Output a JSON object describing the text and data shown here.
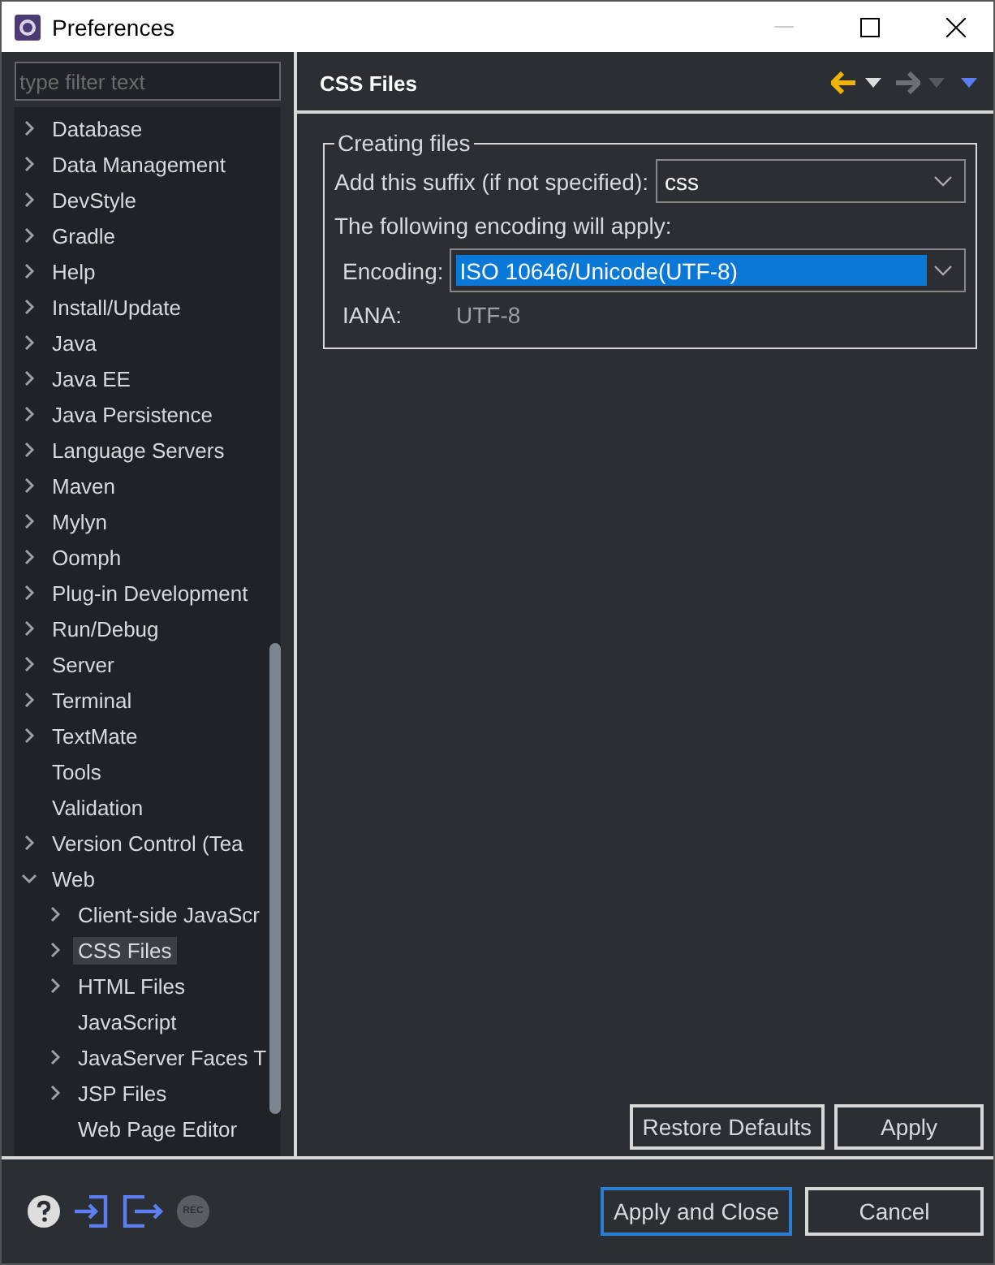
{
  "window": {
    "title": "Preferences"
  },
  "filter": {
    "placeholder": "type filter text"
  },
  "tree": [
    {
      "label": "Database",
      "kind": "branch",
      "expanded": false,
      "selected": false
    },
    {
      "label": "Data Management",
      "kind": "branch",
      "expanded": false,
      "selected": false
    },
    {
      "label": "DevStyle",
      "kind": "branch",
      "expanded": false,
      "selected": false
    },
    {
      "label": "Gradle",
      "kind": "branch",
      "expanded": false,
      "selected": false
    },
    {
      "label": "Help",
      "kind": "branch",
      "expanded": false,
      "selected": false
    },
    {
      "label": "Install/Update",
      "kind": "branch",
      "expanded": false,
      "selected": false
    },
    {
      "label": "Java",
      "kind": "branch",
      "expanded": false,
      "selected": false
    },
    {
      "label": "Java EE",
      "kind": "branch",
      "expanded": false,
      "selected": false
    },
    {
      "label": "Java Persistence",
      "kind": "branch",
      "expanded": false,
      "selected": false
    },
    {
      "label": "Language Servers",
      "kind": "branch",
      "expanded": false,
      "selected": false
    },
    {
      "label": "Maven",
      "kind": "branch",
      "expanded": false,
      "selected": false
    },
    {
      "label": "Mylyn",
      "kind": "branch",
      "expanded": false,
      "selected": false
    },
    {
      "label": "Oomph",
      "kind": "branch",
      "expanded": false,
      "selected": false
    },
    {
      "label": "Plug-in Development",
      "kind": "branch",
      "expanded": false,
      "selected": false
    },
    {
      "label": "Run/Debug",
      "kind": "branch",
      "expanded": false,
      "selected": false
    },
    {
      "label": "Server",
      "kind": "branch",
      "expanded": false,
      "selected": false
    },
    {
      "label": "Terminal",
      "kind": "branch",
      "expanded": false,
      "selected": false
    },
    {
      "label": "TextMate",
      "kind": "branch",
      "expanded": false,
      "selected": false
    },
    {
      "label": "Tools",
      "kind": "leaf",
      "selected": false
    },
    {
      "label": "Validation",
      "kind": "leaf",
      "selected": false
    },
    {
      "label": "Version Control (Tea",
      "kind": "branch",
      "expanded": false,
      "selected": false
    },
    {
      "label": "Web",
      "kind": "branch",
      "expanded": true,
      "selected": false,
      "children": [
        {
          "label": "Client-side JavaScr",
          "kind": "branch",
          "expanded": false,
          "selected": false
        },
        {
          "label": "CSS Files",
          "kind": "branch",
          "expanded": false,
          "selected": true
        },
        {
          "label": "HTML Files",
          "kind": "branch",
          "expanded": false,
          "selected": false
        },
        {
          "label": "JavaScript",
          "kind": "leaf",
          "selected": false
        },
        {
          "label": "JavaServer Faces T",
          "kind": "branch",
          "expanded": false,
          "selected": false
        },
        {
          "label": "JSP Files",
          "kind": "branch",
          "expanded": false,
          "selected": false
        },
        {
          "label": "Web Page Editor",
          "kind": "leaf",
          "selected": false
        }
      ]
    }
  ],
  "page": {
    "title": "CSS Files",
    "group": {
      "title": "Creating files",
      "suffix_label": "Add this suffix (if not specified):",
      "suffix_value": "css",
      "note": "The following encoding will apply:",
      "encoding_label": "Encoding:",
      "encoding_value": "ISO 10646/Unicode(UTF-8)",
      "iana_label": "IANA:",
      "iana_value": "UTF-8"
    },
    "buttons": [
      "Restore Defaults",
      "Apply"
    ]
  },
  "footer": {
    "record_label": "REC",
    "buttons": [
      "Apply and Close",
      "Cancel"
    ]
  }
}
